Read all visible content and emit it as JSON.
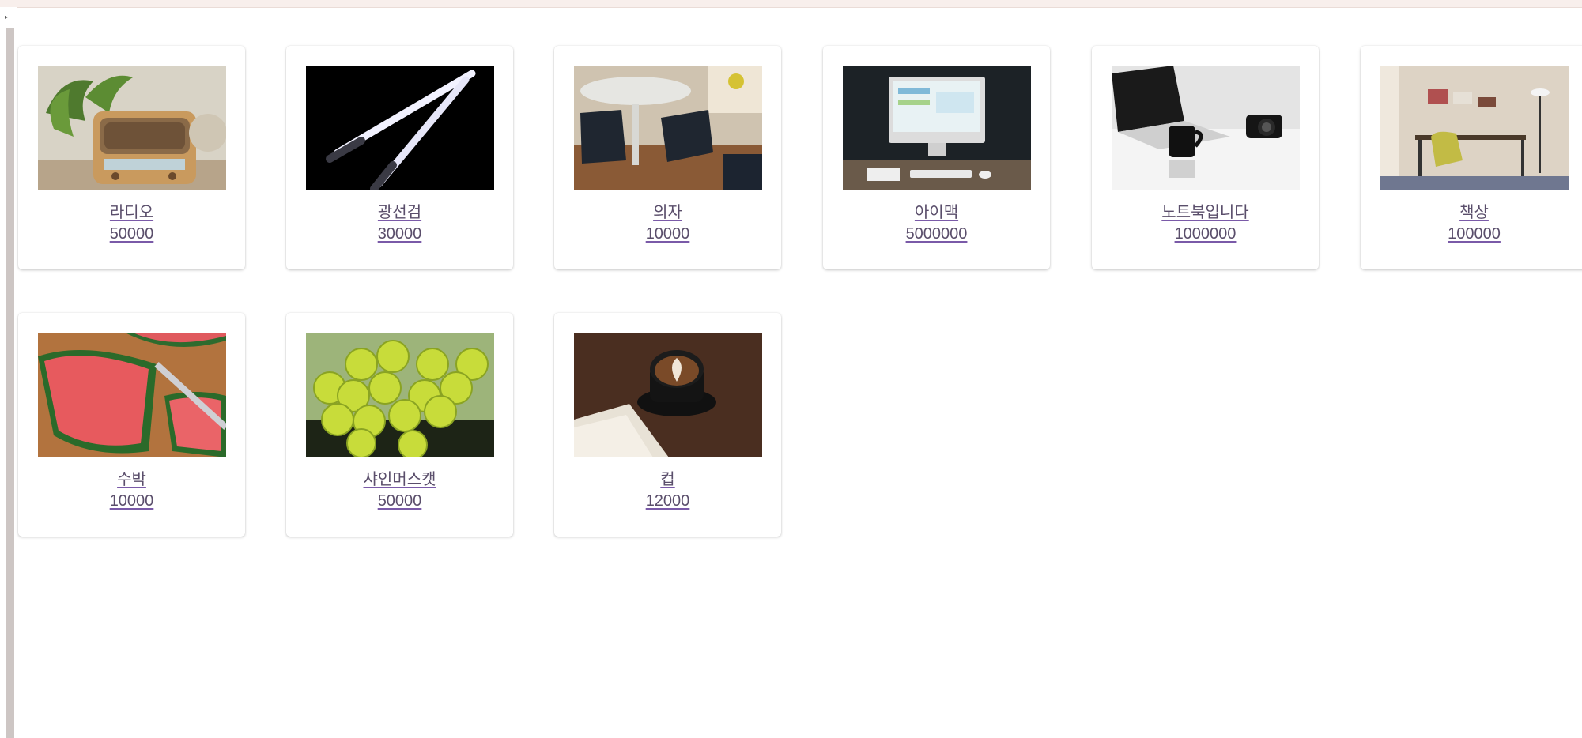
{
  "products": [
    {
      "name": "라디오",
      "price": "50000",
      "image": "radio-photo"
    },
    {
      "name": "광선검",
      "price": "30000",
      "image": "lightsaber-photo"
    },
    {
      "name": "의자",
      "price": "10000",
      "image": "chair-photo"
    },
    {
      "name": "아이맥",
      "price": "5000000",
      "image": "imac-photo"
    },
    {
      "name": "노트북입니다",
      "price": "1000000",
      "image": "laptop-photo"
    },
    {
      "name": "책상",
      "price": "100000",
      "image": "desk-photo"
    },
    {
      "name": "수박",
      "price": "10000",
      "image": "watermelon-photo"
    },
    {
      "name": "샤인머스캣",
      "price": "50000",
      "image": "grapes-photo"
    },
    {
      "name": "컵",
      "price": "12000",
      "image": "coffee-cup-photo"
    }
  ]
}
